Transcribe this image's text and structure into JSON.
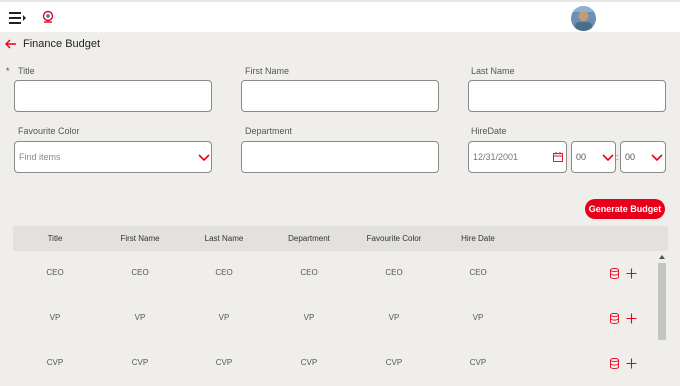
{
  "header": {
    "title": "Finance Budget"
  },
  "form": {
    "required_mark": "*",
    "title_label": "Title",
    "first_name_label": "First Name",
    "last_name_label": "Last Name",
    "favourite_color_label": "Favourite Color",
    "favourite_color_placeholder": "Find items",
    "department_label": "Department",
    "hire_date_label": "HireDate",
    "hire_date_value": "12/31/2001",
    "hour_value": "00",
    "minute_value": "00",
    "time_separator": ":",
    "generate_button": "Generate Budget"
  },
  "table": {
    "columns": [
      "Title",
      "First Name",
      "Last Name",
      "Department",
      "Favourite Color",
      "Hire Date"
    ],
    "rows": [
      [
        "CEO",
        "CEO",
        "CEO",
        "CEO",
        "CEO",
        "CEO"
      ],
      [
        "VP",
        "VP",
        "VP",
        "VP",
        "VP",
        "VP"
      ],
      [
        "CVP",
        "CVP",
        "CVP",
        "CVP",
        "CVP",
        "CVP"
      ]
    ]
  },
  "icons": [
    "menu-icon",
    "app-logo-icon",
    "avatar",
    "back-arrow-icon",
    "chevron-down-icon",
    "calendar-icon",
    "database-icon",
    "plus-icon"
  ],
  "colors": {
    "accent": "#e8001a",
    "background": "#efeeeb",
    "header_row": "#e2e1dd"
  }
}
